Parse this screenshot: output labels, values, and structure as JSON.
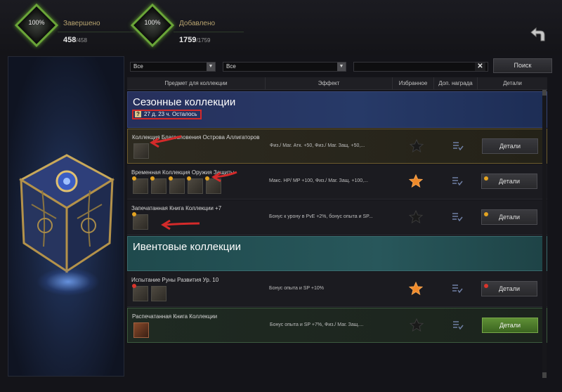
{
  "stats": [
    {
      "percent": "100%",
      "label": "Завершено",
      "value": "458",
      "total": "/458"
    },
    {
      "percent": "100%",
      "label": "Добавлено",
      "value": "1759",
      "total": "/1759"
    }
  ],
  "filters": {
    "select1": "Все",
    "select2": "Все",
    "search_value": "",
    "clear": "✕",
    "search_button": "Поиск"
  },
  "columns": [
    "Предмет для коллекции",
    "Эффект",
    "Избранное",
    "Доп. награда",
    "Детали"
  ],
  "sections": {
    "seasonal": {
      "title": "Сезонные коллекции",
      "timer": "27 д. 23 ч. Осталось",
      "timer_icon": "?"
    },
    "event": {
      "title": "Ивентовые коллекции"
    }
  },
  "rows": [
    {
      "name": "Коллекция Благословения Острова Аллигаторов",
      "effect": "Физ./ Маг. Атк. +50, Физ./ Маг. Защ. +50,...",
      "favorite": false,
      "details": "Детали"
    },
    {
      "name": "Временная Коллекция Оружия Защиты",
      "effect": "Макс. HP/ MP +100, Физ./ Маг. Защ. +100,...",
      "favorite": true,
      "details": "Детали"
    },
    {
      "name": "Запечатанная Книга Коллекции +7",
      "effect": "Бонус к урону в PvE +2%, бонус опыта и SP...",
      "favorite": false,
      "details": "Детали"
    },
    {
      "name": "Испытание Руны Развития Ур. 10",
      "effect": "Бонус опыта и SP +10%",
      "favorite": true,
      "details": "Детали"
    },
    {
      "name": "Распечатанная Книга Коллекции",
      "effect": "Бонус опыта и SP +7%, Физ./ Маг. Защ....",
      "favorite": false,
      "details": "Детали"
    }
  ],
  "colors": {
    "accent_green": "#6aa538",
    "star_active": "#f08a2a",
    "annotation_red": "#d42a2a",
    "gold": "#b8a46f"
  }
}
